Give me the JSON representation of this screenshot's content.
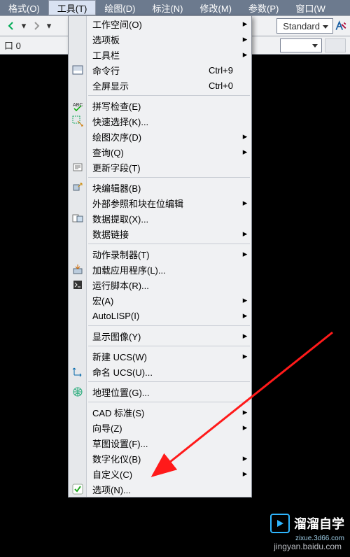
{
  "menubar": {
    "items": [
      {
        "label": "格式(O)"
      },
      {
        "label": "工具(T)"
      },
      {
        "label": "绘图(D)"
      },
      {
        "label": "标注(N)"
      },
      {
        "label": "修改(M)"
      },
      {
        "label": "参数(P)"
      },
      {
        "label": "窗口(W"
      }
    ]
  },
  "toolbar": {
    "style": "Standard"
  },
  "secondary": {
    "layer": "口 0"
  },
  "menu": {
    "g1": [
      {
        "label": "工作空间(O)",
        "sub": true
      },
      {
        "label": "选项板",
        "sub": true
      },
      {
        "label": "工具栏",
        "sub": true
      },
      {
        "label": "命令行",
        "accel": "Ctrl+9",
        "icon": "cmdline"
      },
      {
        "label": "全屏显示",
        "accel": "Ctrl+0"
      }
    ],
    "g2": [
      {
        "label": "拼写检查(E)",
        "icon": "spell"
      },
      {
        "label": "快速选择(K)...",
        "icon": "qselect"
      },
      {
        "label": "绘图次序(D)",
        "sub": true
      },
      {
        "label": "查询(Q)",
        "sub": true
      },
      {
        "label": "更新字段(T)",
        "icon": "update"
      }
    ],
    "g3": [
      {
        "label": "块编辑器(B)",
        "icon": "blockedit"
      },
      {
        "label": "外部参照和块在位编辑",
        "sub": true
      },
      {
        "label": "数据提取(X)...",
        "icon": "dataext"
      },
      {
        "label": "数据链接",
        "sub": true
      }
    ],
    "g4": [
      {
        "label": "动作录制器(T)",
        "sub": true
      },
      {
        "label": "加载应用程序(L)...",
        "icon": "loadapp"
      },
      {
        "label": "运行脚本(R)...",
        "icon": "script"
      },
      {
        "label": "宏(A)",
        "sub": true
      },
      {
        "label": "AutoLISP(I)",
        "sub": true
      }
    ],
    "g5": [
      {
        "label": "显示图像(Y)",
        "sub": true
      }
    ],
    "g6": [
      {
        "label": "新建 UCS(W)",
        "sub": true
      },
      {
        "label": "命名 UCS(U)...",
        "icon": "ucs"
      }
    ],
    "g7": [
      {
        "label": "地理位置(G)...",
        "icon": "geo"
      }
    ],
    "g8": [
      {
        "label": "CAD 标准(S)",
        "sub": true
      },
      {
        "label": "向导(Z)",
        "sub": true
      },
      {
        "label": "草图设置(F)..."
      },
      {
        "label": "数字化仪(B)",
        "sub": true
      },
      {
        "label": "自定义(C)",
        "sub": true
      },
      {
        "label": "选项(N)...",
        "icon": "check"
      }
    ]
  },
  "watermark": {
    "text": "溜溜自学",
    "sub": "zixue.3d66.com"
  },
  "source": "jingyan.baidu.com",
  "submenu_arrow": "▸"
}
